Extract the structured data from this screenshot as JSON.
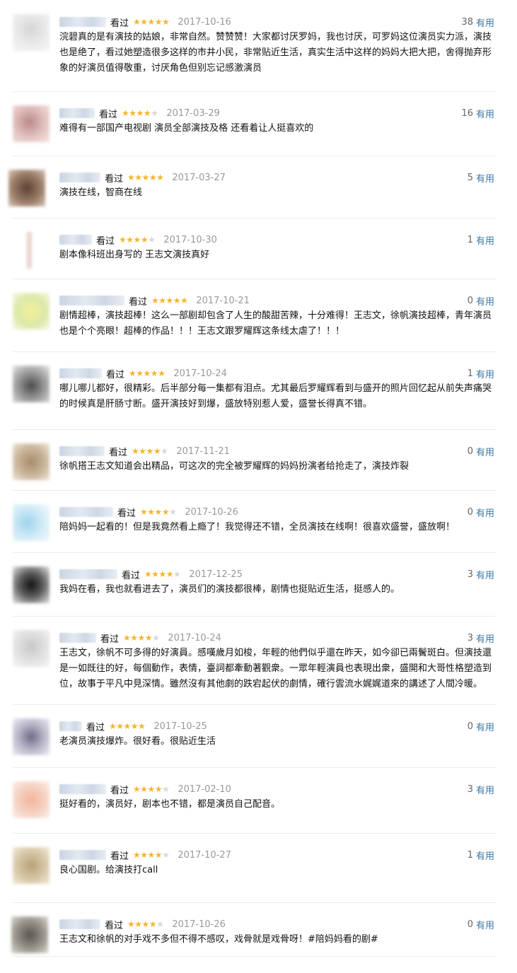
{
  "watched_label": "看过",
  "useful_label": "有用",
  "colors": {
    "star": "#f7b42c",
    "star_empty": "#d8d8d8",
    "link": "#3377aa",
    "date": "#999999",
    "divider": "#ececec"
  },
  "reviews": [
    {
      "date": "2017-10-16",
      "stars": 5,
      "votes": "38",
      "text": "浣碧真的是有演技的姑娘，非常自然。赞赞赞！大家都讨厌罗妈，我也讨厌，可罗妈这位演员实力派，演技也是绝了，看过她塑造很多这样的市井小民，非常贴近生活，真实生活中这样的妈妈大把大把，舍得抛弃形象的好演员值得敬重，讨厌角色但别忘记感激演员"
    },
    {
      "date": "2017-03-29",
      "stars": 4,
      "votes": "16",
      "text": "难得有一部国产电视剧 演员全部演技及格 还看着让人挺喜欢的"
    },
    {
      "date": "2017-03-27",
      "stars": 5,
      "votes": "5",
      "text": "演技在线，智商在线"
    },
    {
      "date": "2017-10-30",
      "stars": 4,
      "votes": "1",
      "text": "剧本像科班出身写的 王志文演技真好"
    },
    {
      "date": "2017-10-21",
      "stars": 5,
      "votes": "0",
      "text": "剧情超棒，演技超棒！这么一部剧却包含了人生的酸甜苦辣，十分难得！王志文，徐帆演技超棒，青年演员也是个个亮眼！超棒的作品！！！王志文跟罗耀辉这条线太虐了！！！"
    },
    {
      "date": "2017-10-24",
      "stars": 5,
      "votes": "1",
      "text": "哪儿哪儿都好，很精彩。后半部分每一集都有泪点。尤其最后罗耀辉看到与盛开的照片回忆起从前失声痛哭的时候真是肝肠寸断。盛开演技好到爆，盛放特别惹人爱，盛誉长得真不错。"
    },
    {
      "date": "2017-11-21",
      "stars": 4,
      "votes": "0",
      "text": "徐帆搭王志文知道会出精品，可这次的完全被罗耀辉的妈妈扮演者给抢走了，演技炸裂"
    },
    {
      "date": "2017-10-26",
      "stars": 4,
      "votes": "0",
      "text": "陪妈妈一起看的！但是我竟然看上瘾了！我觉得还不错，全员演技在线啊！很喜欢盛誉，盛放啊！"
    },
    {
      "date": "2017-12-25",
      "stars": 4,
      "votes": "3",
      "text": "我妈在看，我也就看进去了，演员们的演技都很棒，剧情也挺贴近生活，挺感人的。"
    },
    {
      "date": "2017-10-24",
      "stars": 4,
      "votes": "3",
      "text": "王志文，徐帆不可多得的好演員。感嘆歲月如梭，年輕的他們似乎還在昨天，如今卻已兩鬢斑白。但演技還是一如既往的好，每個動作，表情，臺詞都牽動著觀衆。一眾年輕演員也表現出衆，盛開和大哥性格塑造到位，故事于平凡中見深情。雖然沒有其他劇的跌宕起伏的劇情，確行雲流水娓娓道來的講述了人間冷暖。"
    },
    {
      "date": "2017-10-25",
      "stars": 5,
      "votes": "0",
      "text": "老演员演技爆炸。很好看。很贴近生活"
    },
    {
      "date": "2017-02-10",
      "stars": 4,
      "votes": "3",
      "text": "挺好看的，演员好，剧本也不错，都是演员自己配音。"
    },
    {
      "date": "2017-10-27",
      "stars": 4,
      "votes": "1",
      "text": "良心国剧。给演技打call"
    },
    {
      "date": "2017-10-26",
      "stars": 4,
      "votes": "0",
      "text": "王志文和徐帆的对手戏不多但不得不感叹，戏骨就是戏骨呀！#陪妈妈看的剧#"
    }
  ]
}
